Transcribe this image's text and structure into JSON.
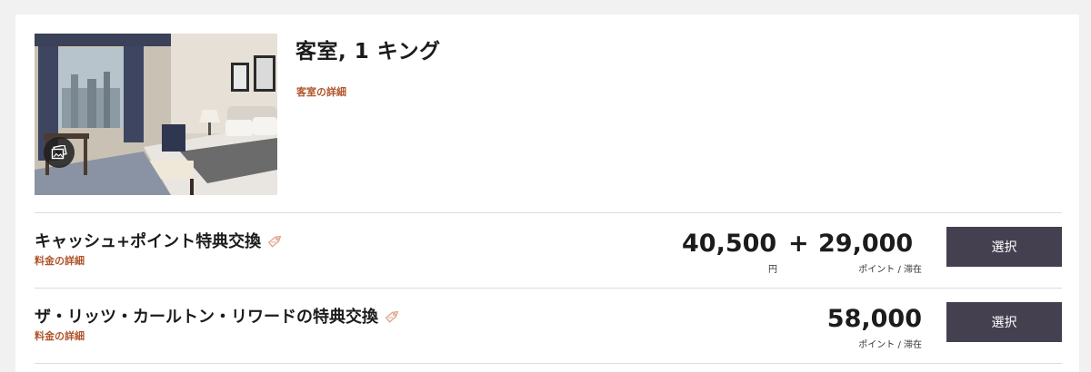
{
  "room": {
    "title": "客室, 1 キング",
    "details_link": "客室の詳細",
    "photo_icon": "gallery-icon"
  },
  "rates": [
    {
      "name": "キャッシュ+ポイント特典交換",
      "details_link": "料金の詳細",
      "tag_icon": "tag-icon",
      "cash_amount": "40,500",
      "cash_unit": "円",
      "plus": "+",
      "points_amount": "29,000",
      "points_unit": "ポイント / 滞在",
      "select_label": "選択"
    },
    {
      "name": "ザ・リッツ・カールトン・リワードの特典交換",
      "details_link": "料金の詳細",
      "tag_icon": "tag-icon",
      "points_amount": "58,000",
      "points_unit": "ポイント / 滞在",
      "select_label": "選択"
    }
  ],
  "colors": {
    "accent_link": "#b0542b",
    "button_bg": "#44404f",
    "tag_icon": "#e0a48a"
  }
}
